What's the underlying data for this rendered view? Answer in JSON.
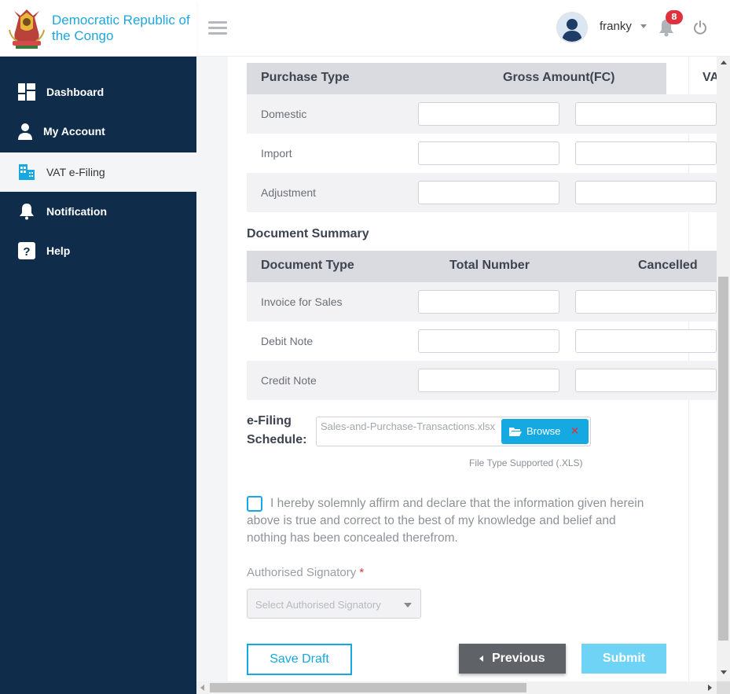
{
  "brand": {
    "name": "Democratic Republic of the Congo"
  },
  "header": {
    "username": "franky",
    "notification_count": "8"
  },
  "sidebar": {
    "items": [
      {
        "label": "Dashboard",
        "icon": "dashboard-icon"
      },
      {
        "label": "My Account",
        "icon": "user-icon"
      },
      {
        "label": "VAT e-Filing",
        "icon": "building-icon",
        "active": true
      },
      {
        "label": "Notification",
        "icon": "bell-icon"
      },
      {
        "label": "Help",
        "icon": "help-icon"
      }
    ]
  },
  "purchase_table": {
    "headers": [
      "Purchase Type",
      "Gross Amount(FC)",
      "VA"
    ],
    "rows": [
      "Domestic",
      "Import",
      "Adjustment"
    ]
  },
  "document_summary": {
    "title": "Document Summary",
    "headers": [
      "Document Type",
      "Total Number",
      "Cancelled"
    ],
    "rows": [
      "Invoice for Sales",
      "Debit Note",
      "Credit Note"
    ]
  },
  "efiling": {
    "label": "e-Filing Schedule:",
    "file_name": "Sales-and-Purchase-Transactions.xlsx",
    "browse_label": "Browse",
    "remove_symbol": "×",
    "hint": "File Type Supported (.XLS)"
  },
  "declaration": {
    "text": "I hereby solemnly affirm and declare that the information given herein above is true and correct to the best of my knowledge and belief and nothing has been concealed therefrom."
  },
  "signatory": {
    "label": "Authorised Signatory",
    "required_mark": "*",
    "placeholder": "Select Authorised Signatory"
  },
  "actions": {
    "save_draft": "Save Draft",
    "previous": "Previous",
    "submit": "Submit"
  },
  "colors": {
    "sidebar_bg": "#0f2c4a",
    "accent": "#14a9e0",
    "table_header": "#d9dbe0",
    "badge": "#e0313c"
  }
}
